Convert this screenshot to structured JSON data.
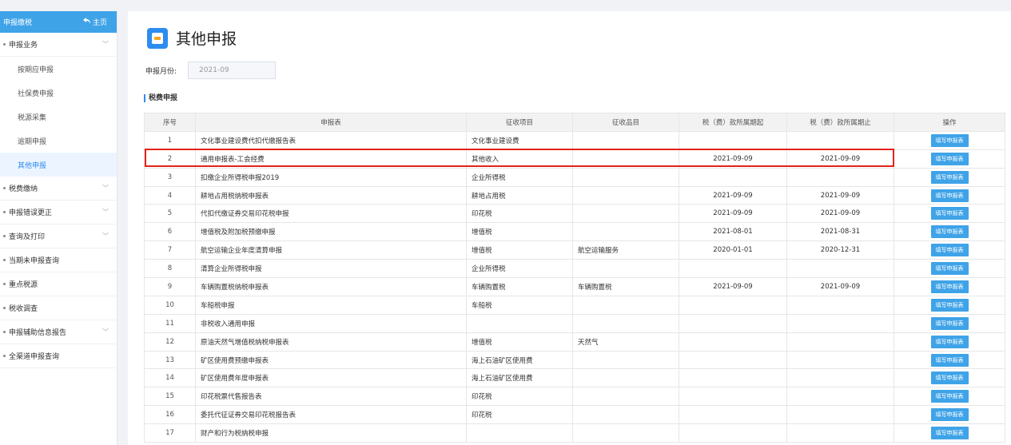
{
  "sidebar": {
    "header_title": "申报缴税",
    "home_label": "主页",
    "groups": [
      {
        "label": "申报业务",
        "expandable": true
      },
      {
        "label": "税费缴纳",
        "expandable": true
      },
      {
        "label": "申报错误更正",
        "expandable": true
      },
      {
        "label": "查询及打印",
        "expandable": true
      },
      {
        "label": "当期未申报查询",
        "expandable": false
      },
      {
        "label": "重点税源",
        "expandable": false
      },
      {
        "label": "税收调查",
        "expandable": false
      },
      {
        "label": "申报辅助信息报告",
        "expandable": true
      },
      {
        "label": "全渠道申报查询",
        "expandable": false
      }
    ],
    "sub_items": [
      "按期应申报",
      "社保费申报",
      "税源采集",
      "逾期申报",
      "其他申报"
    ],
    "active_sub": "其他申报"
  },
  "page": {
    "title": "其他申报",
    "month_label": "申报月份:",
    "month_value": "2021-09",
    "section_title": "税费申报"
  },
  "table": {
    "headers": [
      "序号",
      "申报表",
      "征收项目",
      "征收品目",
      "税（费）款所属期起",
      "税（费）款所属期止",
      "操作"
    ],
    "action_label": "填写申报表",
    "rows": [
      [
        "1",
        "文化事业建设费代扣代缴报告表",
        "文化事业建设费",
        "",
        "",
        ""
      ],
      [
        "2",
        "通用申报表-工会经费",
        "其他收入",
        "",
        "2021-09-09",
        "2021-09-09"
      ],
      [
        "3",
        "扣缴企业所得税申报2019",
        "企业所得税",
        "",
        "",
        ""
      ],
      [
        "4",
        "耕地占用税纳税申报表",
        "耕地占用税",
        "",
        "2021-09-09",
        "2021-09-09"
      ],
      [
        "5",
        "代扣代缴证券交易印花税申报",
        "印花税",
        "",
        "2021-09-09",
        "2021-09-09"
      ],
      [
        "6",
        "增值税及附加税预缴申报",
        "增值税",
        "",
        "2021-08-01",
        "2021-08-31"
      ],
      [
        "7",
        "航空运输企业年度清算申报",
        "增值税",
        "航空运输服务",
        "2020-01-01",
        "2020-12-31"
      ],
      [
        "8",
        "清算企业所得税申报",
        "企业所得税",
        "",
        "",
        ""
      ],
      [
        "9",
        "车辆购置税纳税申报表",
        "车辆购置税",
        "车辆购置税",
        "2021-09-09",
        "2021-09-09"
      ],
      [
        "10",
        "车船税申报",
        "车船税",
        "",
        "",
        ""
      ],
      [
        "11",
        "非税收入通用申报",
        "",
        "",
        "",
        ""
      ],
      [
        "12",
        "原油天然气增值税纳税申报表",
        "增值税",
        "天然气",
        "",
        ""
      ],
      [
        "13",
        "矿区使用费预缴申报表",
        "海上石油矿区使用费",
        "",
        "",
        ""
      ],
      [
        "14",
        "矿区使用费年度申报表",
        "海上石油矿区使用费",
        "",
        "",
        ""
      ],
      [
        "15",
        "印花税票代售报告表",
        "印花税",
        "",
        "",
        ""
      ],
      [
        "16",
        "委托代征证券交易印花税报告表",
        "印花税",
        "",
        "",
        ""
      ],
      [
        "17",
        "财产和行为税纳税申报",
        "",
        "",
        "",
        ""
      ]
    ],
    "highlighted_row": "2"
  },
  "colors": {
    "accent": "#3fa3e8",
    "highlight": "#e2231a"
  }
}
